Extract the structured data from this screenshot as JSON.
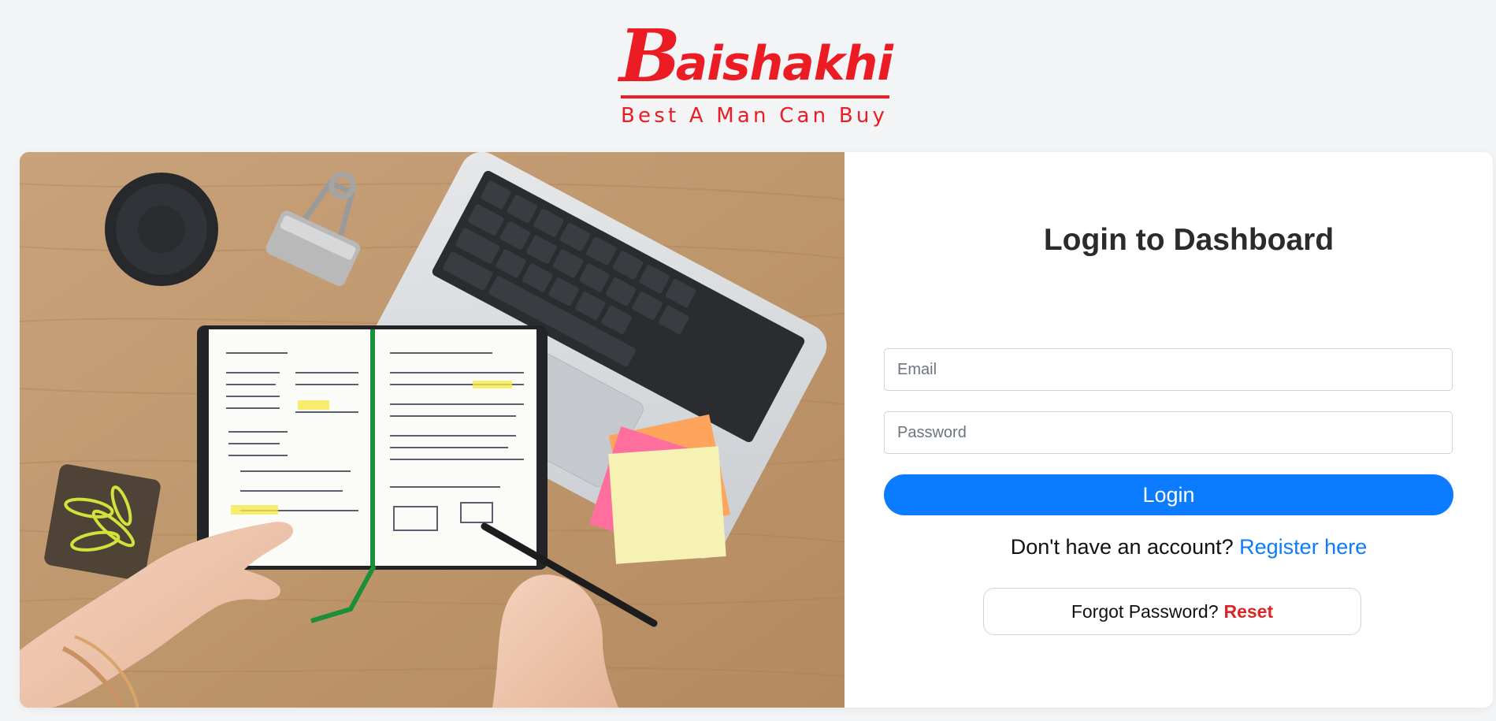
{
  "brand": {
    "initial": "B",
    "name_rest": "aishakhi",
    "tagline": "Best A Man Can Buy",
    "color": "#ec1c24"
  },
  "hero": {
    "image": "workspace-desk-photo"
  },
  "login_form": {
    "title": "Login to Dashboard",
    "email": {
      "placeholder": "Email",
      "value": ""
    },
    "password": {
      "placeholder": "Password",
      "value": ""
    },
    "login_label": "Login",
    "register_prompt": "Don't have an account?",
    "register_link": "Register here",
    "forgot_prompt": "Forgot Password?",
    "reset_link": "Reset"
  },
  "colors": {
    "primary": "#0b7bff",
    "danger": "#dc2626",
    "background": "#f3f4f6"
  }
}
